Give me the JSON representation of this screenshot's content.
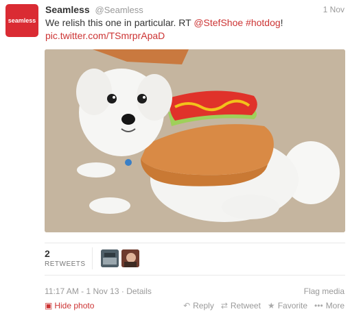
{
  "tweet": {
    "avatar_text": "seamless",
    "fullname": "Seamless",
    "username": "@Seamless",
    "timestamp": "1 Nov",
    "text_plain": "We relish this one in particular. RT ",
    "mention": "@StefShoe",
    "hashtag": "#hotdog",
    "text_end": "!",
    "photo_link": "pic.twitter.com/TSmrprApaD"
  },
  "stats": {
    "retweet_count": "2",
    "retweet_label": "RETWEETS"
  },
  "meta": {
    "time": "11:17 AM - 1 Nov 13",
    "separator": " · ",
    "details": "Details",
    "flag_media": "Flag media"
  },
  "actions": {
    "hide_photo": "Hide photo",
    "reply": "Reply",
    "retweet": "Retweet",
    "favorite": "Favorite",
    "more": "More"
  },
  "colors": {
    "brand": "#da2b33",
    "link": "#cc3333",
    "muted": "#999999"
  }
}
